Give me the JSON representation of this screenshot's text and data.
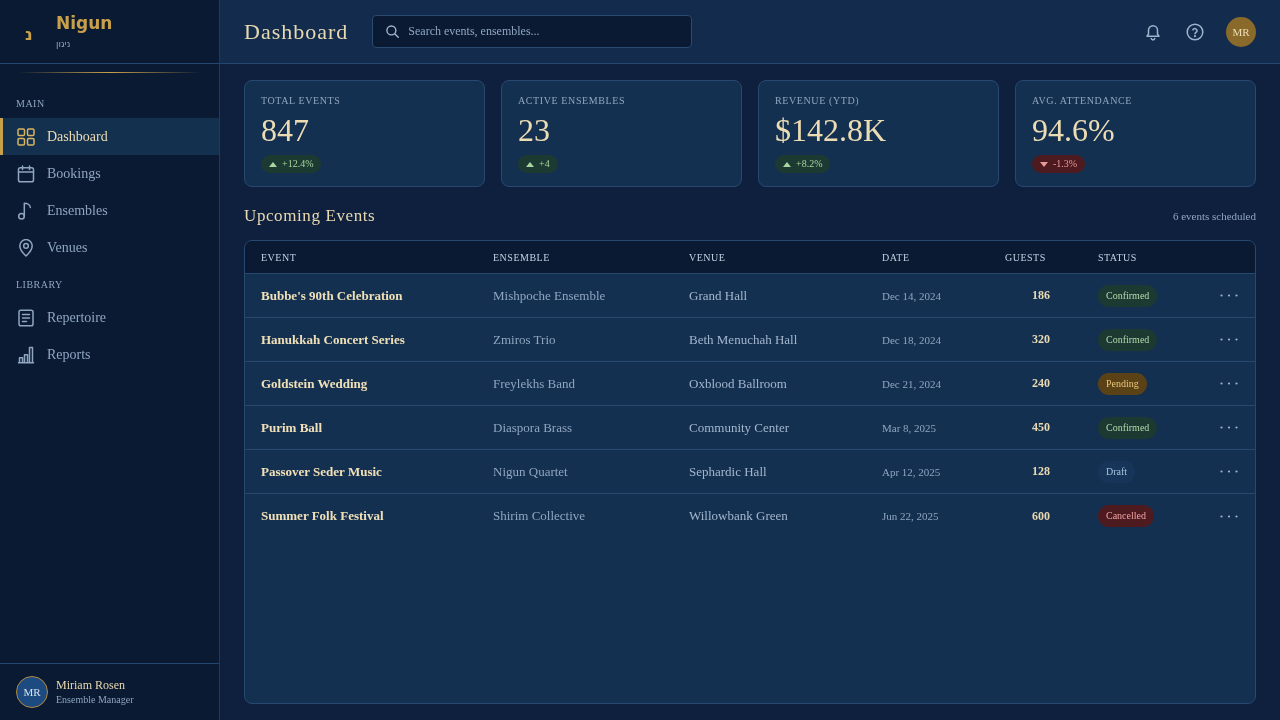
{
  "sidebar": {
    "logo": {
      "mark": "נ",
      "name": "Nigun",
      "subtitle": "ניגון"
    },
    "sections": [
      {
        "label": "MAIN",
        "items": [
          {
            "label": "Dashboard",
            "selected": true
          },
          {
            "label": "Bookings",
            "selected": false
          },
          {
            "label": "Ensembles",
            "selected": false
          },
          {
            "label": "Venues",
            "selected": false
          }
        ]
      },
      {
        "label": "LIBRARY",
        "items": [
          {
            "label": "Repertoire",
            "selected": false
          },
          {
            "label": "Reports",
            "selected": false
          }
        ]
      }
    ],
    "user": {
      "initials": "MR",
      "name": "Miriam Rosen",
      "role": "Ensemble Manager"
    }
  },
  "header": {
    "title": "Dashboard",
    "search": {
      "placeholder": "Search events, ensembles..."
    },
    "avatar_initials": "MR"
  },
  "stats": [
    {
      "label": "TOTAL EVENTS",
      "value": "847",
      "change": "+12.4%",
      "rising": true
    },
    {
      "label": "ACTIVE ENSEMBLES",
      "value": "23",
      "change": "+4",
      "rising": true
    },
    {
      "label": "REVENUE (YTD)",
      "value": "$142.8K",
      "change": "+8.2%",
      "rising": true
    },
    {
      "label": "AVG. ATTENDANCE",
      "value": "94.6%",
      "change": "-1.3%",
      "rising": false
    }
  ],
  "events": {
    "title": "Upcoming Events",
    "count": "6 events scheduled",
    "columns": [
      "EVENT",
      "ENSEMBLE",
      "VENUE",
      "DATE",
      "GUESTS",
      "STATUS"
    ],
    "rows": [
      {
        "event": "Bubbe's 90th Celebration",
        "ensemble": "Mishpoche Ensemble",
        "venue": "Grand Hall",
        "date": "Dec 14, 2024",
        "guests": "186",
        "status": {
          "label": "Confirmed",
          "kind": "confirmed"
        }
      },
      {
        "event": "Hanukkah Concert Series",
        "ensemble": "Zmiros Trio",
        "venue": "Beth Menuchah Hall",
        "date": "Dec 18, 2024",
        "guests": "320",
        "status": {
          "label": "Confirmed",
          "kind": "confirmed"
        }
      },
      {
        "event": "Goldstein Wedding",
        "ensemble": "Freylekhs Band",
        "venue": "Oxblood Ballroom",
        "date": "Dec 21, 2024",
        "guests": "240",
        "status": {
          "label": "Pending",
          "kind": "pending"
        }
      },
      {
        "event": "Purim Ball",
        "ensemble": "Diaspora Brass",
        "venue": "Community Center",
        "date": "Mar 8, 2025",
        "guests": "450",
        "status": {
          "label": "Confirmed",
          "kind": "confirmed"
        }
      },
      {
        "event": "Passover Seder Music",
        "ensemble": "Nigun Quartet",
        "venue": "Sephardic Hall",
        "date": "Apr 12, 2025",
        "guests": "128",
        "status": {
          "label": "Draft",
          "kind": "draft"
        }
      },
      {
        "event": "Summer Folk Festival",
        "ensemble": "Shirim Collective",
        "venue": "Willowbank Green",
        "date": "Jun 22, 2025",
        "guests": "600",
        "status": {
          "label": "Cancelled",
          "kind": "cancelled"
        }
      }
    ]
  }
}
